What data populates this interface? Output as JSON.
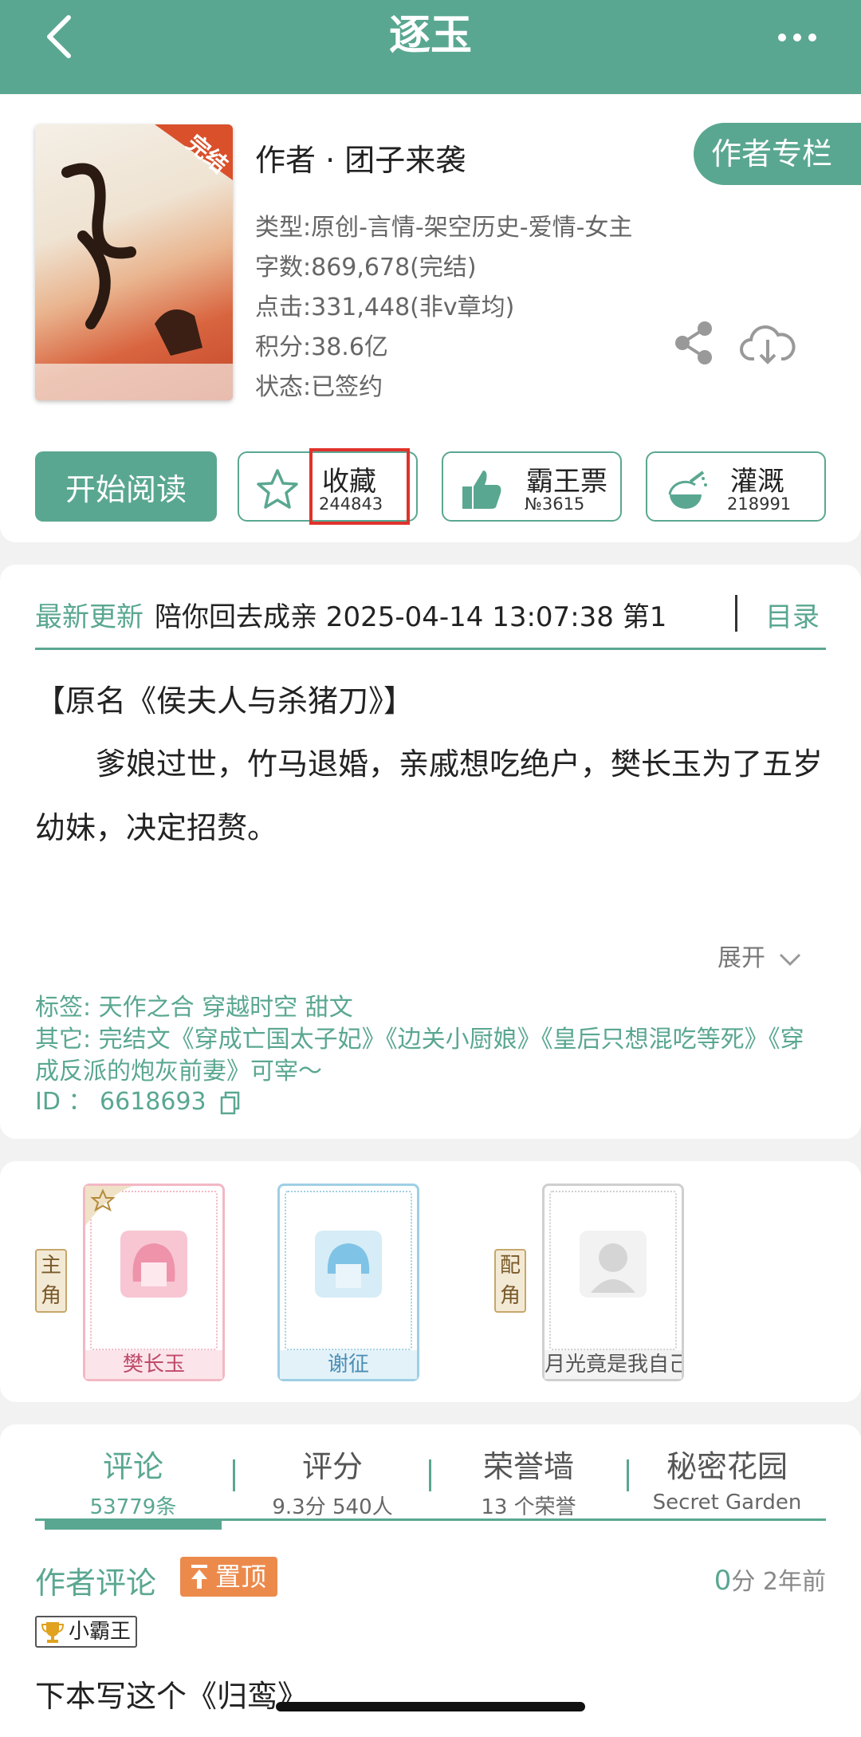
{
  "header": {
    "title": "逐玉",
    "back_icon": "chevron-left-icon",
    "more_icon": "more-dots-icon"
  },
  "book": {
    "author_line": "作者 · 团子来袭",
    "author_column_btn": "作者专栏",
    "type": "类型:原创-言情-架空历史-爱情-女主",
    "words": "字数:869,678(完结)",
    "clicks": "点击:331,448(非v章均)",
    "points": "积分:38.6亿",
    "status": "状态:已签约"
  },
  "actions": {
    "start_read": "开始阅读",
    "collect": {
      "label": "收藏",
      "count": "244843"
    },
    "bawang": {
      "label": "霸王票",
      "count": "№3615"
    },
    "irrigate": {
      "label": "灌溉",
      "count": "218991"
    }
  },
  "latest": {
    "label": "最新更新",
    "text": "陪你回去成亲 2025-04-14 13:07:38  第1",
    "toc": "目录"
  },
  "desc": {
    "original_name": "【原名《侯夫人与杀猪刀》】",
    "synopsis": "爹娘过世，竹马退婚，亲戚想吃绝户，樊长玉为了五岁幼妹，决定招赘。",
    "expand": "展开",
    "tags": "标签: 天作之合  穿越时空  甜文",
    "others": "其它:  完结文《穿成亡国太子妃》《边关小厨娘》《皇后只想混吃等死》《穿成反派的炮灰前妻》可宰～",
    "id": "ID   ：  6618693"
  },
  "roles": {
    "main_tag": "主角",
    "support_tag": "配角",
    "cards": [
      {
        "name": "樊长玉"
      },
      {
        "name": "谢征"
      },
      {
        "name": "月光竟是我自己"
      }
    ]
  },
  "tabs": [
    {
      "title": "评论",
      "sub": "53779条"
    },
    {
      "title": "评分",
      "sub": "9.3分 540人"
    },
    {
      "title": "荣誉墙",
      "sub": "13 个荣誉"
    },
    {
      "title": "秘密花园",
      "sub": "Secret Garden"
    }
  ],
  "comment": {
    "header": "作者评论",
    "pin": "置顶",
    "score_num": "0",
    "score_rest": "分 2年前",
    "rank": "小霸王",
    "text": "下本写这个《归鸾》"
  },
  "colors": {
    "accent": "#5aa791",
    "highlight": "#e0322c",
    "pin": "#ec8a4c"
  }
}
